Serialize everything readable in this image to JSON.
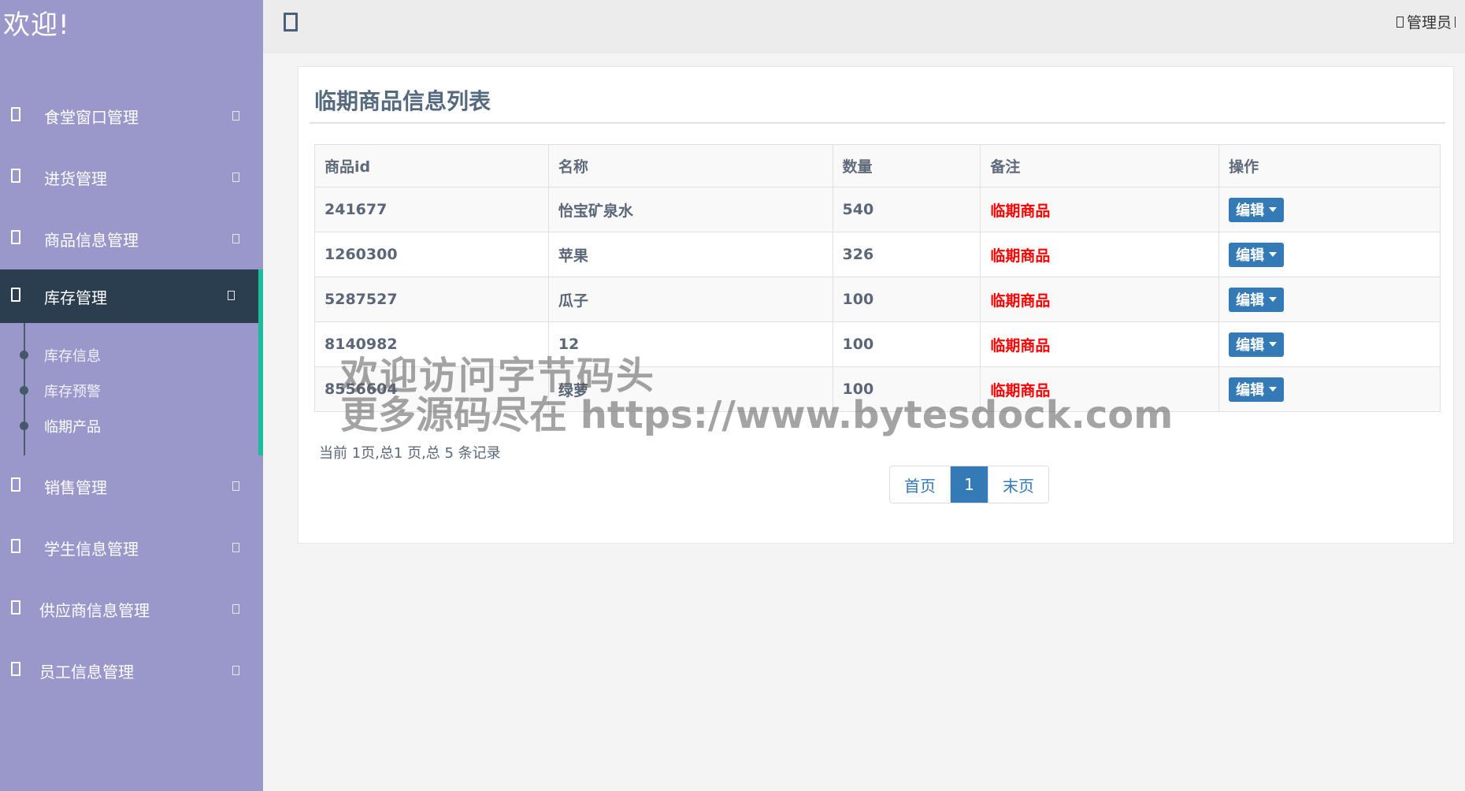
{
  "sidebar": {
    "brand": "欢迎!",
    "menu": [
      {
        "label": "食堂窗口管理"
      },
      {
        "label": "进货管理"
      },
      {
        "label": "商品信息管理"
      },
      {
        "label": "库存管理"
      },
      {
        "label": "销售管理"
      },
      {
        "label": "学生信息管理"
      },
      {
        "label": "供应商信息管理"
      },
      {
        "label": "员工信息管理"
      }
    ],
    "submenu": [
      {
        "label": "库存信息"
      },
      {
        "label": "库存预警"
      },
      {
        "label": "临期产品"
      }
    ]
  },
  "topbar": {
    "user": "管理员"
  },
  "panel": {
    "title": "临期商品信息列表",
    "headers": [
      "商品id",
      "名称",
      "数量",
      "备注",
      "操作"
    ],
    "rows": [
      {
        "id": "241677",
        "name": "怡宝矿泉水",
        "qty": "540",
        "note": "临期商品",
        "op": "编辑"
      },
      {
        "id": "1260300",
        "name": "苹果",
        "qty": "326",
        "note": "临期商品",
        "op": "编辑"
      },
      {
        "id": "5287527",
        "name": "瓜子",
        "qty": "100",
        "note": "临期商品",
        "op": "编辑"
      },
      {
        "id": "8140982",
        "name": "12",
        "qty": "100",
        "note": "临期商品",
        "op": "编辑"
      },
      {
        "id": "8556604",
        "name": "绿萝",
        "qty": "100",
        "note": "临期商品",
        "op": "编辑"
      }
    ],
    "page_info": "当前 1页,总1 页,总 5 条记录",
    "pager": {
      "first": "首页",
      "current": "1",
      "last": "末页"
    }
  },
  "watermark": {
    "line1": "欢迎访问字节码头",
    "line2": "更多源码尽在  https://www.bytesdock.com"
  },
  "colors": {
    "sidebar_bg": "#9a97cb",
    "active_bg": "#2b3e50",
    "active_accent": "#1abc9c",
    "button_primary": "#337ab7",
    "note_red": "#ff0000"
  }
}
